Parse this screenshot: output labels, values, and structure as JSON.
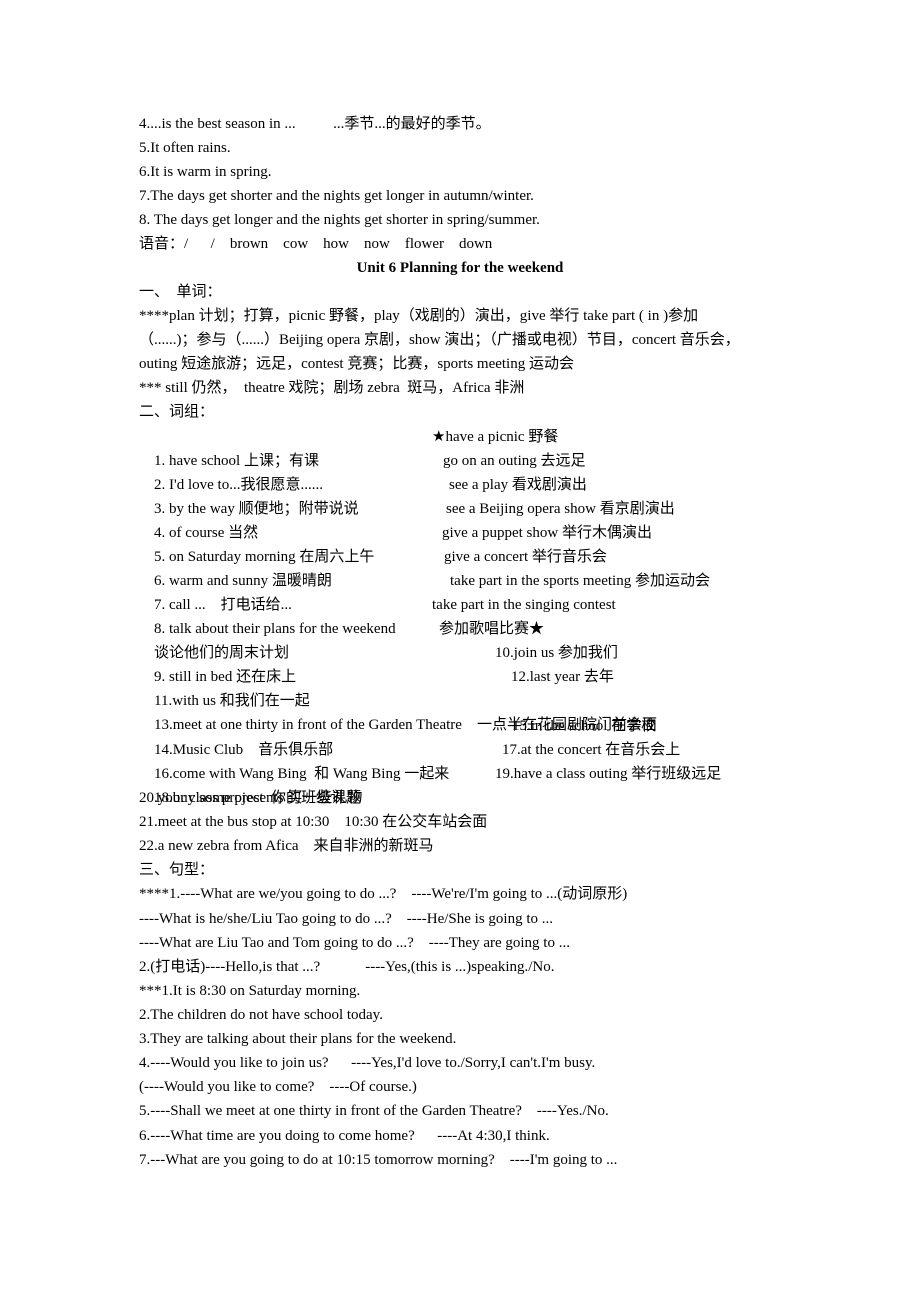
{
  "previous_section": {
    "lines": [
      "4....is the best season in ...          ...季节...的最好的季节。",
      "5.It often rains.",
      "6.It is warm in spring.",
      "7.The days get shorter and the nights get longer in autumn/winter.",
      "8. The days get longer and the nights get shorter in spring/summer.",
      "语音：/      /    brown    cow    how    now    flower    down"
    ]
  },
  "unit": {
    "title": "Unit 6    Planning for the weekend"
  },
  "vocabulary": {
    "heading": "一、  单词：",
    "lines": [
      "****plan 计划；打算，picnic 野餐，play（戏剧的）演出，give 举行 take part ( in )参加",
      "（......)；参与（......）Beijing opera 京剧，show 演出；（广播或电视）节目，concert 音乐会，",
      "outing 短途旅游；远足，contest 竞赛；比赛，sports meeting 运动会",
      "*** still 仍然，  theatre 戏院；剧场 zebra  斑马，Africa 非洲"
    ]
  },
  "phrases": {
    "heading": "二、词组：",
    "rows": [
      {
        "left": "1. have school 上课；有课",
        "right": "★have a picnic 野餐"
      },
      {
        "left": "2. I'd love to...我很愿意......",
        "right": "go on an outing 去远足"
      },
      {
        "left": "3. by the way 顺便地；附带说说",
        "right": "see a play 看戏剧演出"
      },
      {
        "left": "4. of course 当然",
        "right": "see a Beijing opera show 看京剧演出"
      },
      {
        "left": "5. on Saturday morning 在周六上午",
        "right": "give a puppet show 举行木偶演出"
      },
      {
        "left": "6. warm and sunny 温暖晴朗",
        "right": "give a concert 举行音乐会"
      },
      {
        "left": "7. call ...    打电话给...",
        "right": "take part in the sports meeting 参加运动会"
      },
      {
        "left": "8. talk about their plans for the weekend",
        "right": "take part in the singing contest"
      },
      {
        "left": "谈论他们的周末计划",
        "right": "参加歌唱比赛★"
      },
      {
        "left": "9. still in bed 还在床上",
        "right": "10.join us 参加我们"
      },
      {
        "left": "11.with us 和我们在一起",
        "right": "12.last year 去年"
      },
      {
        "left": "13.meet at one thirty in front of the Garden Theatre    一点半在花园剧院门前会面",
        "right": ""
      },
      {
        "left": "14.Music Club    音乐俱乐部",
        "right": "15.in the school 在学校"
      },
      {
        "left": "16.come with Wang Bing  和 Wang Bing 一起来",
        "right": "17.at the concert 在音乐会上"
      },
      {
        "left": "18.buy some presents 买一些礼物",
        "right": "19.have a class outing 举行班级远足"
      },
      {
        "left": "20.your class project  你的班级课题",
        "right": ""
      },
      {
        "left": "21.meet at the bus stop at 10:30    10:30 在公交车站会面",
        "right": ""
      },
      {
        "left": "22.a new zebra from Afica    来自非洲的新斑马",
        "right": ""
      }
    ]
  },
  "sentences": {
    "heading": "三、句型：",
    "lines": [
      "****1.----What are we/you going to do ...?    ----We're/I'm going to ...(动词原形)",
      "----What is he/she/Liu Tao going to do ...?    ----He/She is going to ...",
      "----What are Liu Tao and Tom going to do ...?    ----They are going to ...",
      "2.(打电话)----Hello,is that ...?            ----Yes,(this is ...)speaking./No.",
      "***1.It is 8:30 on Saturday morning.",
      "2.The children do not have school today.",
      "3.They are talking about their plans for the weekend.",
      "4.----Would you like to join us?      ----Yes,I'd love to./Sorry,I can't.I'm busy.",
      "(----Would you like to come?    ----Of course.)",
      "5.----Shall we meet at one thirty in front of the Garden Theatre?    ----Yes./No.",
      "6.----What time are you doing to come home?      ----At 4:30,I think.",
      "7.---What are you going to do at 10:15 tomorrow morning?    ----I'm going to ..."
    ]
  }
}
